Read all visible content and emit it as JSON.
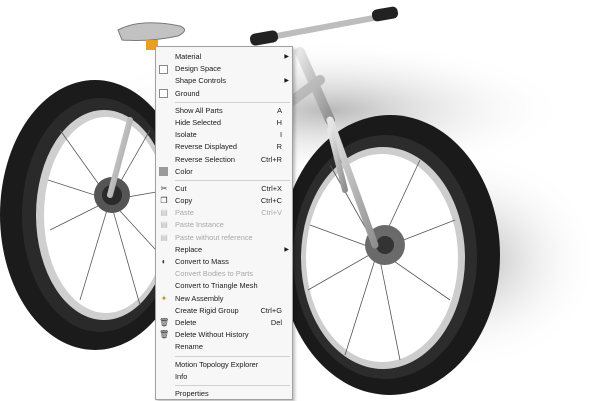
{
  "menu": {
    "group1": [
      {
        "label": "Material",
        "submenu": true,
        "icon": "none"
      },
      {
        "label": "Design Space",
        "checkbox": true
      },
      {
        "label": "Shape Controls",
        "submenu": true
      },
      {
        "label": "Ground",
        "checkbox": true
      }
    ],
    "group2": [
      {
        "label": "Show All Parts",
        "shortcut": "A"
      },
      {
        "label": "Hide Selected",
        "shortcut": "H"
      },
      {
        "label": "Isolate",
        "shortcut": "I"
      },
      {
        "label": "Reverse Displayed",
        "shortcut": "R"
      },
      {
        "label": "Reverse Selection",
        "shortcut": "Ctrl+R"
      },
      {
        "label": "Color",
        "icon": "color-swatch-icon"
      }
    ],
    "group3": [
      {
        "label": "Cut",
        "shortcut": "Ctrl+X",
        "icon": "scissors-icon"
      },
      {
        "label": "Copy",
        "shortcut": "Ctrl+C",
        "icon": "copy-icon"
      },
      {
        "label": "Paste",
        "shortcut": "Ctrl+V",
        "icon": "paste-icon",
        "disabled": true
      },
      {
        "label": "Paste Instance",
        "icon": "paste-instance-icon",
        "disabled": true
      },
      {
        "label": "Paste without reference",
        "icon": "paste-reference-icon",
        "disabled": true
      },
      {
        "label": "Replace",
        "submenu": true
      },
      {
        "label": "Convert to Mass",
        "icon": "mass-icon"
      },
      {
        "label": "Convert Bodies to Parts",
        "disabled": true
      },
      {
        "label": "Convert to Triangle Mesh"
      },
      {
        "label": "New Assembly",
        "icon": "assembly-icon"
      },
      {
        "label": "Create Rigid Group",
        "shortcut": "Ctrl+G"
      },
      {
        "label": "Delete",
        "shortcut": "Del",
        "icon": "trash-icon"
      },
      {
        "label": "Delete Without History",
        "icon": "trash-icon"
      },
      {
        "label": "Rename"
      }
    ],
    "group4": [
      {
        "label": "Motion Topology Explorer"
      },
      {
        "label": "Info"
      }
    ],
    "group5": [
      {
        "label": "Properties"
      }
    ]
  },
  "colors": {
    "menu_bg": "#f7f7f7",
    "disabled_text": "#a8a8a8",
    "tire": "#1a1a1a",
    "frame": "#c9c9c9",
    "saddle_clamp": "#e8a020"
  }
}
